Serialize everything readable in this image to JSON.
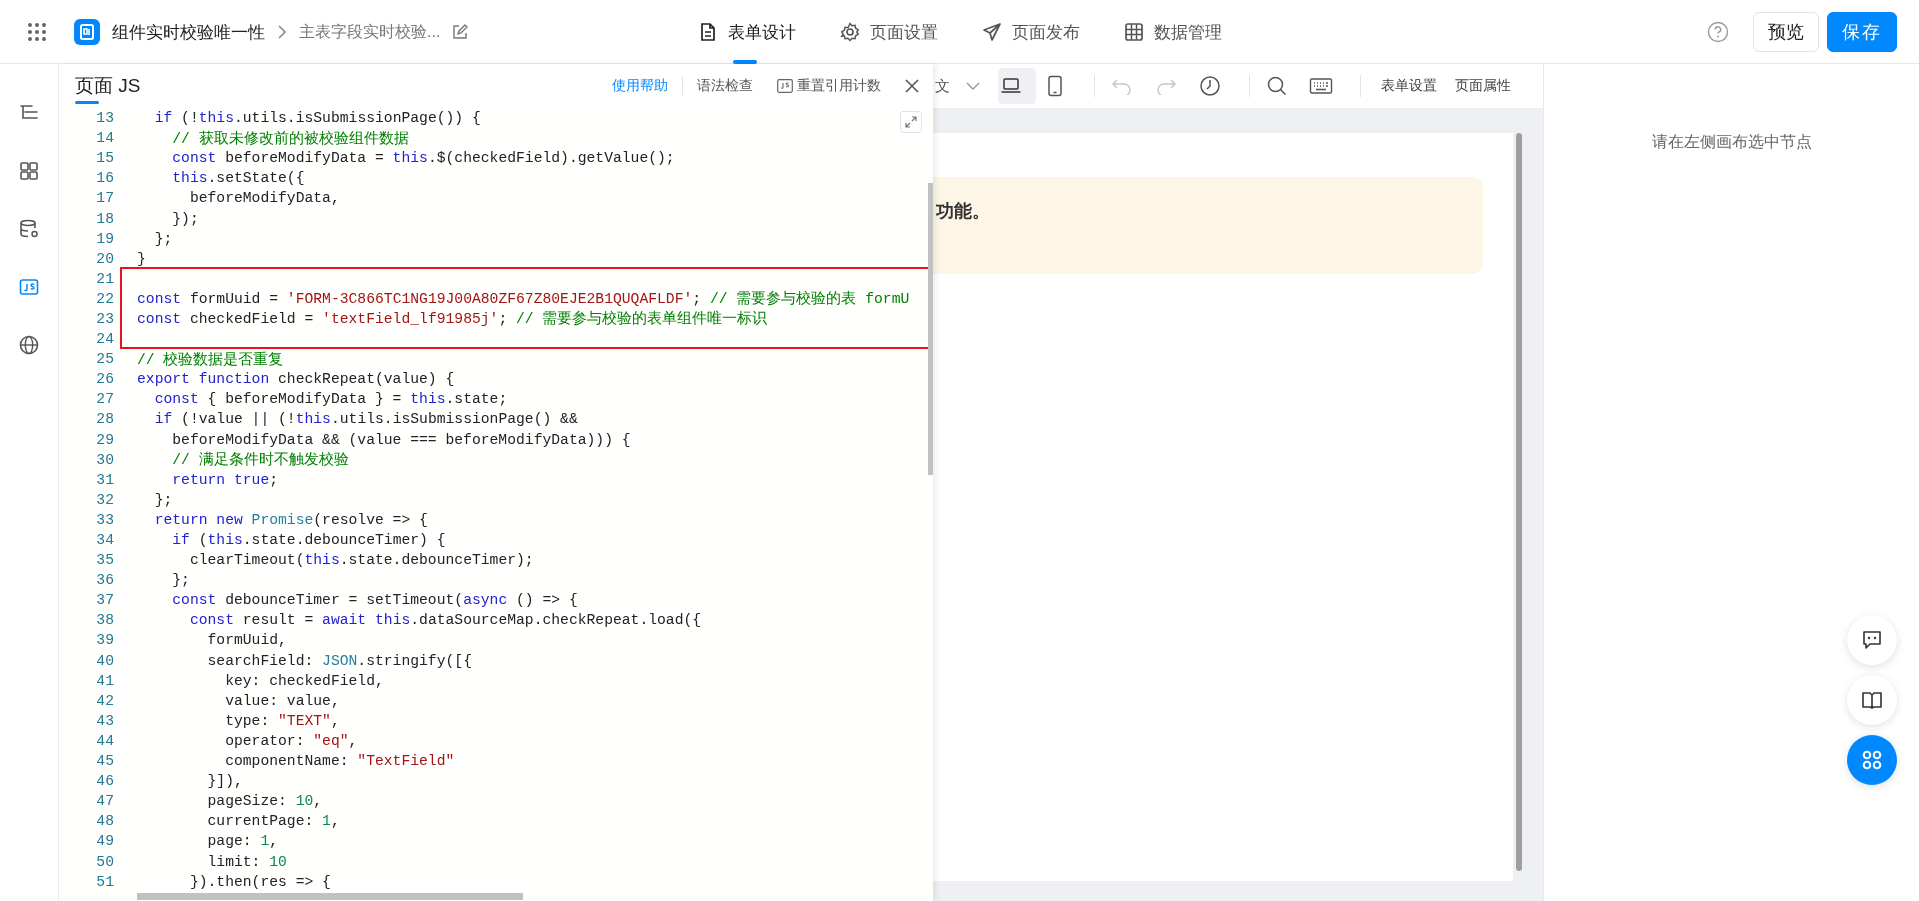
{
  "header": {
    "app_name": "组件实时校验唯一性",
    "page_name": "主表字段实时校验...",
    "tabs": [
      {
        "label": "表单设计",
        "kind": "form",
        "selected": true
      },
      {
        "label": "页面设置",
        "kind": "gear",
        "selected": false
      },
      {
        "label": "页面发布",
        "kind": "send",
        "selected": false
      },
      {
        "label": "数据管理",
        "kind": "grid",
        "selected": false
      }
    ],
    "buttons": [
      {
        "label": "预览",
        "kind": "secondary"
      },
      {
        "label": "保存",
        "kind": "primary"
      }
    ]
  },
  "sidebar": {
    "items": [
      {
        "kind": "outline",
        "selected": false
      },
      {
        "kind": "components",
        "selected": false
      },
      {
        "kind": "datasource",
        "selected": false
      },
      {
        "kind": "js",
        "selected": true
      },
      {
        "kind": "globe",
        "selected": false
      }
    ]
  },
  "js_panel": {
    "title": "页面 JS",
    "actions": [
      {
        "label": "使用帮助",
        "kind": "link"
      },
      {
        "label": "语法检查",
        "kind": "plain"
      },
      {
        "label": "重置引用计数",
        "kind": "js"
      }
    ],
    "lines": [
      {
        "number": "13",
        "highlighted": false,
        "tokens": [
          {
            "text": "  if",
            "kind": "keyword"
          },
          {
            "text": " (!",
            "kind": "plain"
          },
          {
            "text": "this",
            "kind": "keyword"
          },
          {
            "text": ".utils.isSubmissionPage()) {",
            "kind": "plain"
          }
        ]
      },
      {
        "number": "14",
        "highlighted": false,
        "tokens": [
          {
            "text": "    // 获取未修改前的被校验组件数据",
            "kind": "comment"
          }
        ]
      },
      {
        "number": "15",
        "highlighted": false,
        "tokens": [
          {
            "text": "    const",
            "kind": "keyword"
          },
          {
            "text": " beforeModifyData = ",
            "kind": "plain"
          },
          {
            "text": "this",
            "kind": "keyword"
          },
          {
            "text": ".$(checkedField).getValue();",
            "kind": "plain"
          }
        ]
      },
      {
        "number": "16",
        "highlighted": false,
        "tokens": [
          {
            "text": "    this",
            "kind": "keyword"
          },
          {
            "text": ".setState({",
            "kind": "plain"
          }
        ]
      },
      {
        "number": "17",
        "highlighted": false,
        "tokens": [
          {
            "text": "      beforeModifyData,",
            "kind": "plain"
          }
        ]
      },
      {
        "number": "18",
        "highlighted": false,
        "tokens": [
          {
            "text": "    });",
            "kind": "plain"
          }
        ]
      },
      {
        "number": "19",
        "highlighted": false,
        "tokens": [
          {
            "text": "  };",
            "kind": "plain"
          }
        ]
      },
      {
        "number": "20",
        "highlighted": false,
        "tokens": [
          {
            "text": "}",
            "kind": "plain"
          }
        ]
      },
      {
        "number": "21",
        "highlighted": true
      },
      {
        "number": "22",
        "highlighted": true,
        "tokens": [
          {
            "text": "const",
            "kind": "keyword"
          },
          {
            "text": " formUuid = ",
            "kind": "plain"
          },
          {
            "text": "'FORM-3C866TC1NG19J00A80ZF67Z80EJE2B1QUQAFLDF'",
            "kind": "string"
          },
          {
            "text": ";",
            "kind": "plain"
          },
          {
            "text": " // 需要参与校验的表 formU",
            "kind": "comment"
          }
        ]
      },
      {
        "number": "23",
        "highlighted": true,
        "tokens": [
          {
            "text": "const",
            "kind": "keyword"
          },
          {
            "text": " checkedField = ",
            "kind": "plain"
          },
          {
            "text": "'textField_lf91985j'",
            "kind": "string"
          },
          {
            "text": ";",
            "kind": "plain"
          },
          {
            "text": " // 需要参与校验的表单组件唯一标识",
            "kind": "comment"
          }
        ]
      },
      {
        "number": "24",
        "highlighted": true
      },
      {
        "number": "25",
        "highlighted": false,
        "tokens": [
          {
            "text": "// 校验数据是否重复",
            "kind": "comment"
          }
        ]
      },
      {
        "number": "26",
        "highlighted": false,
        "tokens": [
          {
            "text": "export",
            "kind": "keyword"
          },
          {
            "text": " function",
            "kind": "keyword"
          },
          {
            "text": " checkRepeat(value) {",
            "kind": "plain"
          }
        ]
      },
      {
        "number": "27",
        "highlighted": false,
        "tokens": [
          {
            "text": "  const",
            "kind": "keyword"
          },
          {
            "text": " { beforeModifyData } = ",
            "kind": "plain"
          },
          {
            "text": "this",
            "kind": "keyword"
          },
          {
            "text": ".state;",
            "kind": "plain"
          }
        ]
      },
      {
        "number": "28",
        "highlighted": false,
        "tokens": [
          {
            "text": "  if",
            "kind": "keyword"
          },
          {
            "text": " (!value || (!",
            "kind": "plain"
          },
          {
            "text": "this",
            "kind": "keyword"
          },
          {
            "text": ".utils.isSubmissionPage() &&",
            "kind": "plain"
          }
        ]
      },
      {
        "number": "29",
        "highlighted": false,
        "tokens": [
          {
            "text": "    beforeModifyData && (value === beforeModifyData))) {",
            "kind": "plain"
          }
        ]
      },
      {
        "number": "30",
        "highlighted": false,
        "tokens": [
          {
            "text": "    // 满足条件时不触发校验",
            "kind": "comment"
          }
        ]
      },
      {
        "number": "31",
        "highlighted": false,
        "tokens": [
          {
            "text": "    return",
            "kind": "keyword"
          },
          {
            "text": " true",
            "kind": "keyword"
          },
          {
            "text": ";",
            "kind": "plain"
          }
        ]
      },
      {
        "number": "32",
        "highlighted": false,
        "tokens": [
          {
            "text": "  };",
            "kind": "plain"
          }
        ]
      },
      {
        "number": "33",
        "highlighted": false,
        "tokens": [
          {
            "text": "  return",
            "kind": "keyword"
          },
          {
            "text": " new",
            "kind": "keyword"
          },
          {
            "text": " Promise",
            "kind": "builtin"
          },
          {
            "text": "(resolve => {",
            "kind": "plain"
          }
        ]
      },
      {
        "number": "34",
        "highlighted": false,
        "tokens": [
          {
            "text": "    if",
            "kind": "keyword"
          },
          {
            "text": " (",
            "kind": "plain"
          },
          {
            "text": "this",
            "kind": "keyword"
          },
          {
            "text": ".state.debounceTimer) {",
            "kind": "plain"
          }
        ]
      },
      {
        "number": "35",
        "highlighted": false,
        "tokens": [
          {
            "text": "      clearTimeout(",
            "kind": "plain"
          },
          {
            "text": "this",
            "kind": "keyword"
          },
          {
            "text": ".state.debounceTimer);",
            "kind": "plain"
          }
        ]
      },
      {
        "number": "36",
        "highlighted": false,
        "tokens": [
          {
            "text": "    };",
            "kind": "plain"
          }
        ]
      },
      {
        "number": "37",
        "highlighted": false,
        "tokens": [
          {
            "text": "    const",
            "kind": "keyword"
          },
          {
            "text": " debounceTimer = setTimeout(",
            "kind": "plain"
          },
          {
            "text": "async",
            "kind": "keyword"
          },
          {
            "text": " () => {",
            "kind": "plain"
          }
        ]
      },
      {
        "number": "38",
        "highlighted": false,
        "tokens": [
          {
            "text": "      const",
            "kind": "keyword"
          },
          {
            "text": " result = ",
            "kind": "plain"
          },
          {
            "text": "await",
            "kind": "keyword"
          },
          {
            "text": " this",
            "kind": "keyword"
          },
          {
            "text": ".dataSourceMap.checkRepeat.load({",
            "kind": "plain"
          }
        ]
      },
      {
        "number": "39",
        "highlighted": false,
        "tokens": [
          {
            "text": "        formUuid,",
            "kind": "plain"
          }
        ]
      },
      {
        "number": "40",
        "highlighted": false,
        "tokens": [
          {
            "text": "        searchField: ",
            "kind": "plain"
          },
          {
            "text": "JSON",
            "kind": "builtin"
          },
          {
            "text": ".stringify([{",
            "kind": "plain"
          }
        ]
      },
      {
        "number": "41",
        "highlighted": false,
        "tokens": [
          {
            "text": "          key: checkedField,",
            "kind": "plain"
          }
        ]
      },
      {
        "number": "42",
        "highlighted": false,
        "tokens": [
          {
            "text": "          value: value,",
            "kind": "plain"
          }
        ]
      },
      {
        "number": "43",
        "highlighted": false,
        "tokens": [
          {
            "text": "          type: ",
            "kind": "plain"
          },
          {
            "text": "\"TEXT\"",
            "kind": "string"
          },
          {
            "text": ",",
            "kind": "plain"
          }
        ]
      },
      {
        "number": "44",
        "highlighted": false,
        "tokens": [
          {
            "text": "          operator: ",
            "kind": "plain"
          },
          {
            "text": "\"eq\"",
            "kind": "string"
          },
          {
            "text": ",",
            "kind": "plain"
          }
        ]
      },
      {
        "number": "45",
        "highlighted": false,
        "tokens": [
          {
            "text": "          componentName: ",
            "kind": "plain"
          },
          {
            "text": "\"TextField\"",
            "kind": "string"
          }
        ]
      },
      {
        "number": "46",
        "highlighted": false,
        "tokens": [
          {
            "text": "        }]),",
            "kind": "plain"
          }
        ]
      },
      {
        "number": "47",
        "highlighted": false,
        "tokens": [
          {
            "text": "        pageSize: ",
            "kind": "plain"
          },
          {
            "text": "10",
            "kind": "number"
          },
          {
            "text": ",",
            "kind": "plain"
          }
        ]
      },
      {
        "number": "48",
        "highlighted": false,
        "tokens": [
          {
            "text": "        currentPage: ",
            "kind": "plain"
          },
          {
            "text": "1",
            "kind": "number"
          },
          {
            "text": ",",
            "kind": "plain"
          }
        ]
      },
      {
        "number": "49",
        "highlighted": false,
        "tokens": [
          {
            "text": "        page: ",
            "kind": "plain"
          },
          {
            "text": "1",
            "kind": "number"
          },
          {
            "text": ",",
            "kind": "plain"
          }
        ]
      },
      {
        "number": "50",
        "highlighted": false,
        "tokens": [
          {
            "text": "        limit: ",
            "kind": "plain"
          },
          {
            "text": "10",
            "kind": "number"
          }
        ]
      },
      {
        "number": "51",
        "highlighted": false,
        "tokens": [
          {
            "text": "      }).then(res => {",
            "kind": "plain"
          }
        ]
      }
    ]
  },
  "toolbar": {
    "language": "文",
    "tools": [
      {
        "kind": "laptop",
        "selected": true
      },
      {
        "kind": "phone",
        "selected": false
      },
      {
        "kind": "undo",
        "disabled": true
      },
      {
        "kind": "redo",
        "disabled": true
      },
      {
        "kind": "history",
        "disabled": false
      },
      {
        "kind": "search",
        "disabled": false
      },
      {
        "kind": "keyboard",
        "disabled": false
      }
    ],
    "buttons": [
      "表单设置",
      "页面属性"
    ]
  },
  "canvas": {
    "notice": {
      "text": "功能。"
    }
  },
  "right_panel": {
    "hint": "请在左侧画布选中节点"
  },
  "floating_buttons": [
    {
      "kind": "chat"
    },
    {
      "kind": "guide"
    },
    {
      "kind": "apps"
    }
  ]
}
